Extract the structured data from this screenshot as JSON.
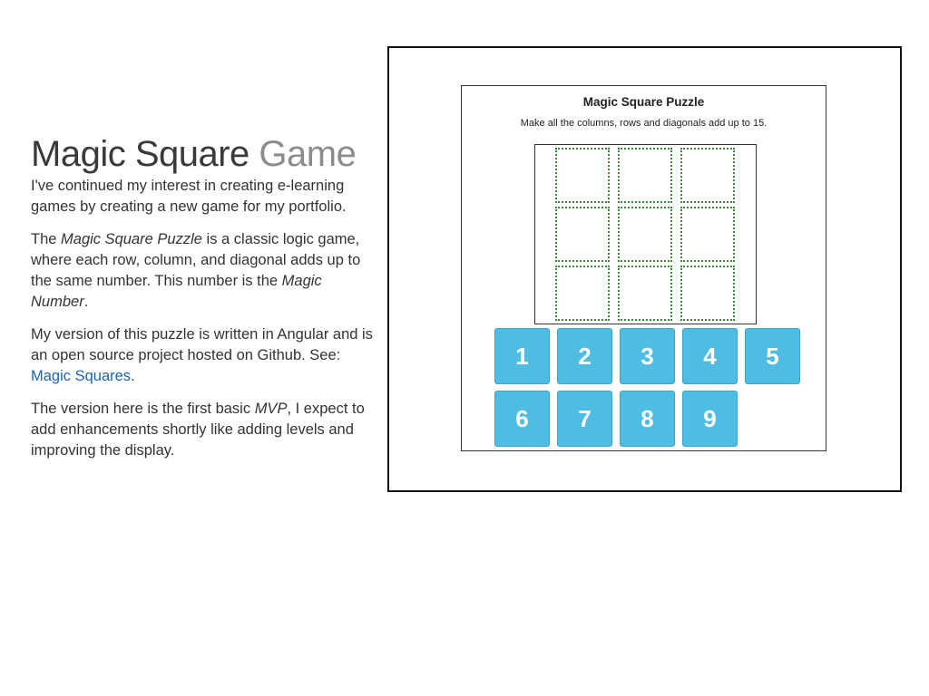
{
  "article": {
    "title_main": "Magic Square",
    "title_muted": "Game",
    "p1": "I've continued my interest in creating e-learning games by creating a new game for my portfolio.",
    "p2_a": "The ",
    "p2_em1": "Magic Square Puzzle",
    "p2_b": " is a classic logic game, where each row, column, and diagonal adds up to the same number. This number is the ",
    "p2_em2": "Magic Number",
    "p2_c": ".",
    "p3_a": "My version of this puzzle is written in Angular and is an open source project hosted on Github. See: ",
    "p3_link": "Magic Squares",
    "p3_b": ".",
    "p4_a": "The version here is the first basic ",
    "p4_em": "MVP",
    "p4_b": ", I expect to add enhancements shortly like adding levels and improving the display."
  },
  "puzzle": {
    "title": "Magic Square Puzzle",
    "instructions": "Make all the columns, rows and diagonals add up to 15.",
    "tiles": [
      "1",
      "2",
      "3",
      "4",
      "5",
      "6",
      "7",
      "8",
      "9"
    ]
  },
  "colors": {
    "tile": "#4fbde2",
    "cell_border": "#3a8a3a",
    "link": "#1c64b4"
  }
}
